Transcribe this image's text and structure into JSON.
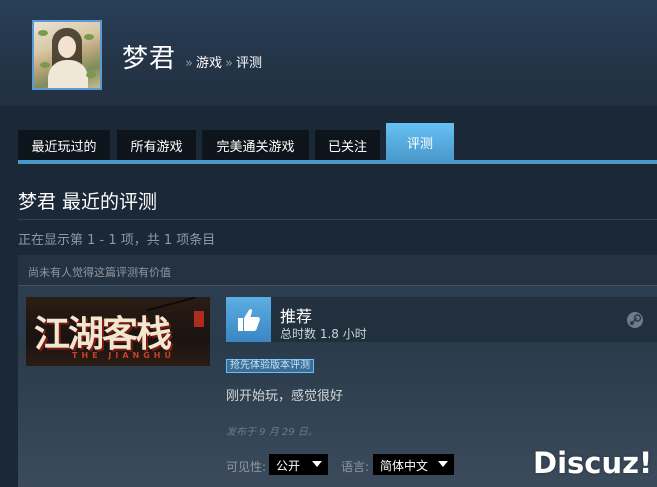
{
  "header": {
    "persona_name": "梦君",
    "breadcrumbs": [
      "游戏",
      "评测"
    ],
    "separator": "»"
  },
  "tabs": [
    {
      "label": "最近玩过的",
      "active": false
    },
    {
      "label": "所有游戏",
      "active": false
    },
    {
      "label": "完美通关游戏",
      "active": false
    },
    {
      "label": "已关注",
      "active": false
    },
    {
      "label": "评测",
      "active": true
    }
  ],
  "section": {
    "title": "梦君 最近的评测",
    "showing": "正在显示第 1 - 1 项，共 1 项条目"
  },
  "review": {
    "helpful_text": "尚未有人觉得这篇评测有价值",
    "game_logo_text": "江湖客栈",
    "game_logo_subtitle": "THE JIANGHU",
    "recommendation": "推荐",
    "hours": "总时数 1.8 小时",
    "early_access_badge": "抢先体验版本评测",
    "text": "刚开始玩，感觉很好",
    "posted": "发布于 9 月 29 日。",
    "visibility_label": "可见性:",
    "visibility_value": "公开",
    "language_label": "语言:",
    "language_value": "简体中文",
    "thumb_icon": "thumbs-up-icon",
    "platform_icon": "steam-icon"
  },
  "watermark": "Discuz!",
  "colors": {
    "background": "#1b2838",
    "accent": "#67c1f5",
    "tab_active": "#4a98c9"
  }
}
